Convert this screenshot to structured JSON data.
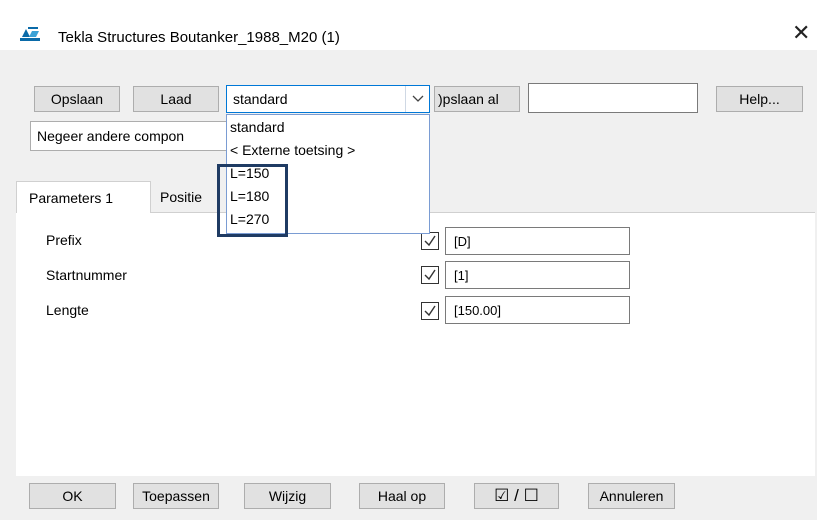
{
  "window": {
    "title": "Tekla Structures  Boutanker_1988_M20 (1)",
    "close_glyph": "✕",
    "app_icon": "tekla-structures-icon"
  },
  "toolbar": {
    "save_label": "Opslaan",
    "load_label": "Laad",
    "settings_value": "standard",
    "save_as_label": ")pslaan al",
    "save_as_name_value": "",
    "help_label": "Help..."
  },
  "component_option": {
    "value": "Negeer andere compon"
  },
  "dropdown": {
    "options": [
      "standard",
      "< Externe toetsing >",
      "L=150",
      "L=180",
      "L=270"
    ]
  },
  "tabs": [
    {
      "label": "Parameters 1",
      "active": true
    },
    {
      "label": "Positie",
      "active": false
    }
  ],
  "parameters": [
    {
      "label": "Prefix",
      "checked": true,
      "value": "[D]"
    },
    {
      "label": "Startnummer",
      "checked": true,
      "value": "[1]"
    },
    {
      "label": "Lengte",
      "checked": true,
      "value": "[150.00]"
    }
  ],
  "footer": {
    "ok_label": "OK",
    "apply_label": "Toepassen",
    "modify_label": "Wijzig",
    "get_label": "Haal op",
    "toggle_label": "☑ / ☐",
    "cancel_label": "Annuleren"
  },
  "colors": {
    "highlight_border": "#1f3b63",
    "dropdown_border": "#7a9cd3",
    "window_bg": "#f0f0f0"
  }
}
